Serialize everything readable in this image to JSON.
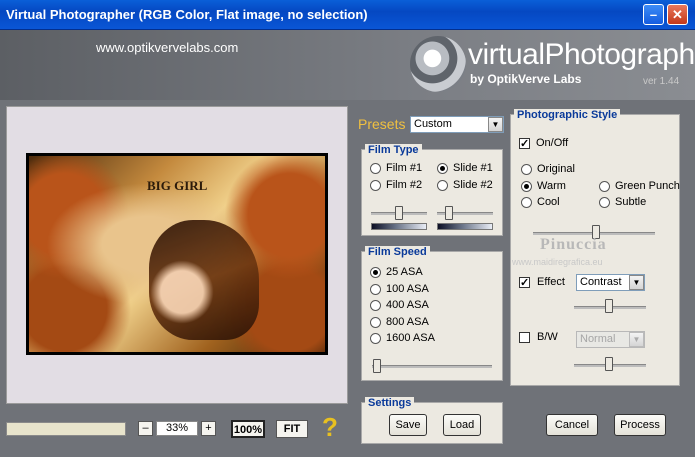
{
  "window": {
    "title": "Virtual Photographer (RGB Color, Flat image, no selection)",
    "minimize_glyph": "–",
    "close_glyph": "✕"
  },
  "header": {
    "website": "www.optikvervelabs.com",
    "brand": "virtualPhotographer",
    "by_line": "by OptikVerve Labs",
    "version": "ver 1.44"
  },
  "preview": {
    "image_caption": "BIG GIRL"
  },
  "toolbar": {
    "progress": 0,
    "zoom_minus": "–",
    "zoom_value": "33%",
    "zoom_plus": "+",
    "actual_size_label": "100%",
    "fit_label": "FIT",
    "help_label": "?"
  },
  "presets": {
    "label": "Presets",
    "selected": "Custom"
  },
  "film_type": {
    "title": "Film Type",
    "options": [
      "Film #1",
      "Slide #1",
      "Film #2",
      "Slide #2"
    ],
    "selected": "Slide #1"
  },
  "film_speed": {
    "title": "Film Speed",
    "options": [
      "25 ASA",
      "100 ASA",
      "400 ASA",
      "800 ASA",
      "1600 ASA"
    ],
    "selected": "25 ASA"
  },
  "settings": {
    "title": "Settings",
    "save_label": "Save",
    "load_label": "Load"
  },
  "photographic_style": {
    "title": "Photographic Style",
    "onoff_label": "On/Off",
    "onoff_checked": true,
    "styles": [
      "Original",
      "Warm",
      "Green Punch",
      "Cool",
      "Subtle"
    ],
    "selected": "Warm",
    "watermark": "Pinuccia",
    "watermark_url": "www.maidiregrafica.eu",
    "effect_label": "Effect",
    "effect_checked": true,
    "effect_value": "Contrast",
    "bw_label": "B/W",
    "bw_checked": false,
    "bw_value": "Normal"
  },
  "actions": {
    "cancel_label": "Cancel",
    "process_label": "Process"
  },
  "colors": {
    "titlebar": "#0548c2",
    "presets_label": "#f0c040",
    "group_title": "#0a3a9a",
    "help_icon": "#e8c020"
  }
}
